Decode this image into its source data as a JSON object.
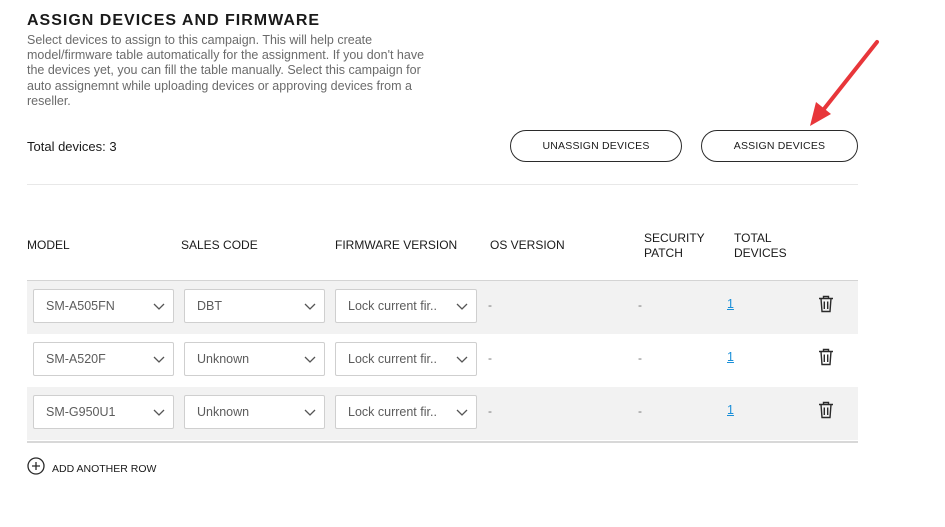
{
  "section": {
    "title": "ASSIGN DEVICES AND FIRMWARE",
    "description": "Select devices to assign to this campaign. This will help create model/firmware table automatically for the assignment. If you don't have the devices yet, you can fill the table manually. Select this campaign for auto assignemnt while uploading devices or approving devices from a reseller."
  },
  "summary": {
    "total_devices_label": "Total devices: 3"
  },
  "actions": {
    "unassign_label": "UNASSIGN DEVICES",
    "assign_label": "ASSIGN DEVICES"
  },
  "table": {
    "headers": {
      "model": "MODEL",
      "sales_code": "SALES CODE",
      "firmware_version": "FIRMWARE VERSION",
      "os_version": "OS VERSION",
      "security_patch_1": "SECURITY",
      "security_patch_2": "PATCH",
      "total_devices_1": "TOTAL",
      "total_devices_2": "DEVICES"
    },
    "rows": [
      {
        "model": "SM-A505FN",
        "sales_code": "DBT",
        "firmware": "Lock current fir..",
        "os_version": "-",
        "security_patch": "-",
        "total": "1"
      },
      {
        "model": "SM-A520F",
        "sales_code": "Unknown",
        "firmware": "Lock current fir..",
        "os_version": "-",
        "security_patch": "-",
        "total": "1"
      },
      {
        "model": "SM-G950U1",
        "sales_code": "Unknown",
        "firmware": "Lock current fir..",
        "os_version": "-",
        "security_patch": "-",
        "total": "1"
      }
    ]
  },
  "add_row_label": "ADD ANOTHER ROW",
  "colors": {
    "link": "#1a8fd8",
    "arrow": "#e8363a",
    "row_alt": "#f2f2f2"
  }
}
